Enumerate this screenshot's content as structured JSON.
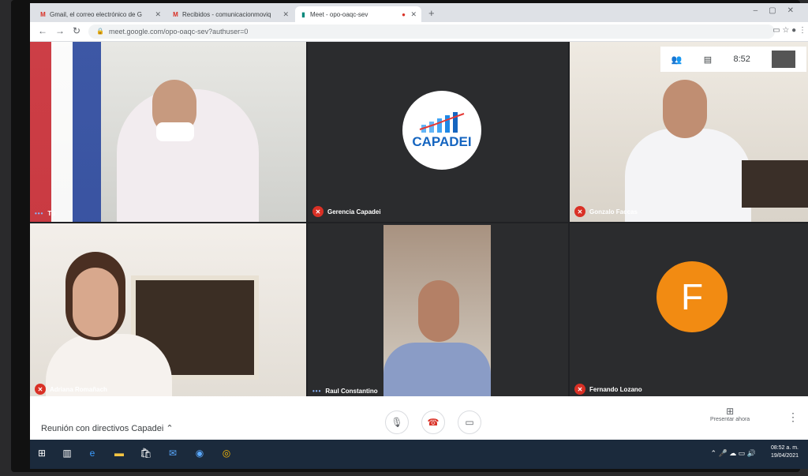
{
  "tabs": [
    {
      "label": "Gmail, el correo electrónico de G",
      "icon": "gmail-icon"
    },
    {
      "label": "Recibidos - comunicacionmoviq",
      "icon": "gmail-icon"
    },
    {
      "label": "Meet - opo-oaqc-sev",
      "icon": "meet-icon"
    }
  ],
  "address": {
    "url": "meet.google.com/opo-oaqc-sev?authuser=0"
  },
  "meet": {
    "time": "8:52",
    "participants": [
      {
        "name": "Tú"
      },
      {
        "name": "Gerencia Capadei",
        "logo": "CAPADEI"
      },
      {
        "name": "Gonzalo Faccas"
      },
      {
        "name": "Adriana Romañach"
      },
      {
        "name": "Raul Constantino"
      },
      {
        "name": "Fernando Lozano",
        "initial": "F",
        "color": "#f28b12"
      }
    ],
    "meeting_title": "Reunión con directivos Capadei",
    "present_label": "Presentar ahora"
  },
  "taskbar": {
    "time": "08:52 a. m.",
    "date": "19/04/2021"
  }
}
